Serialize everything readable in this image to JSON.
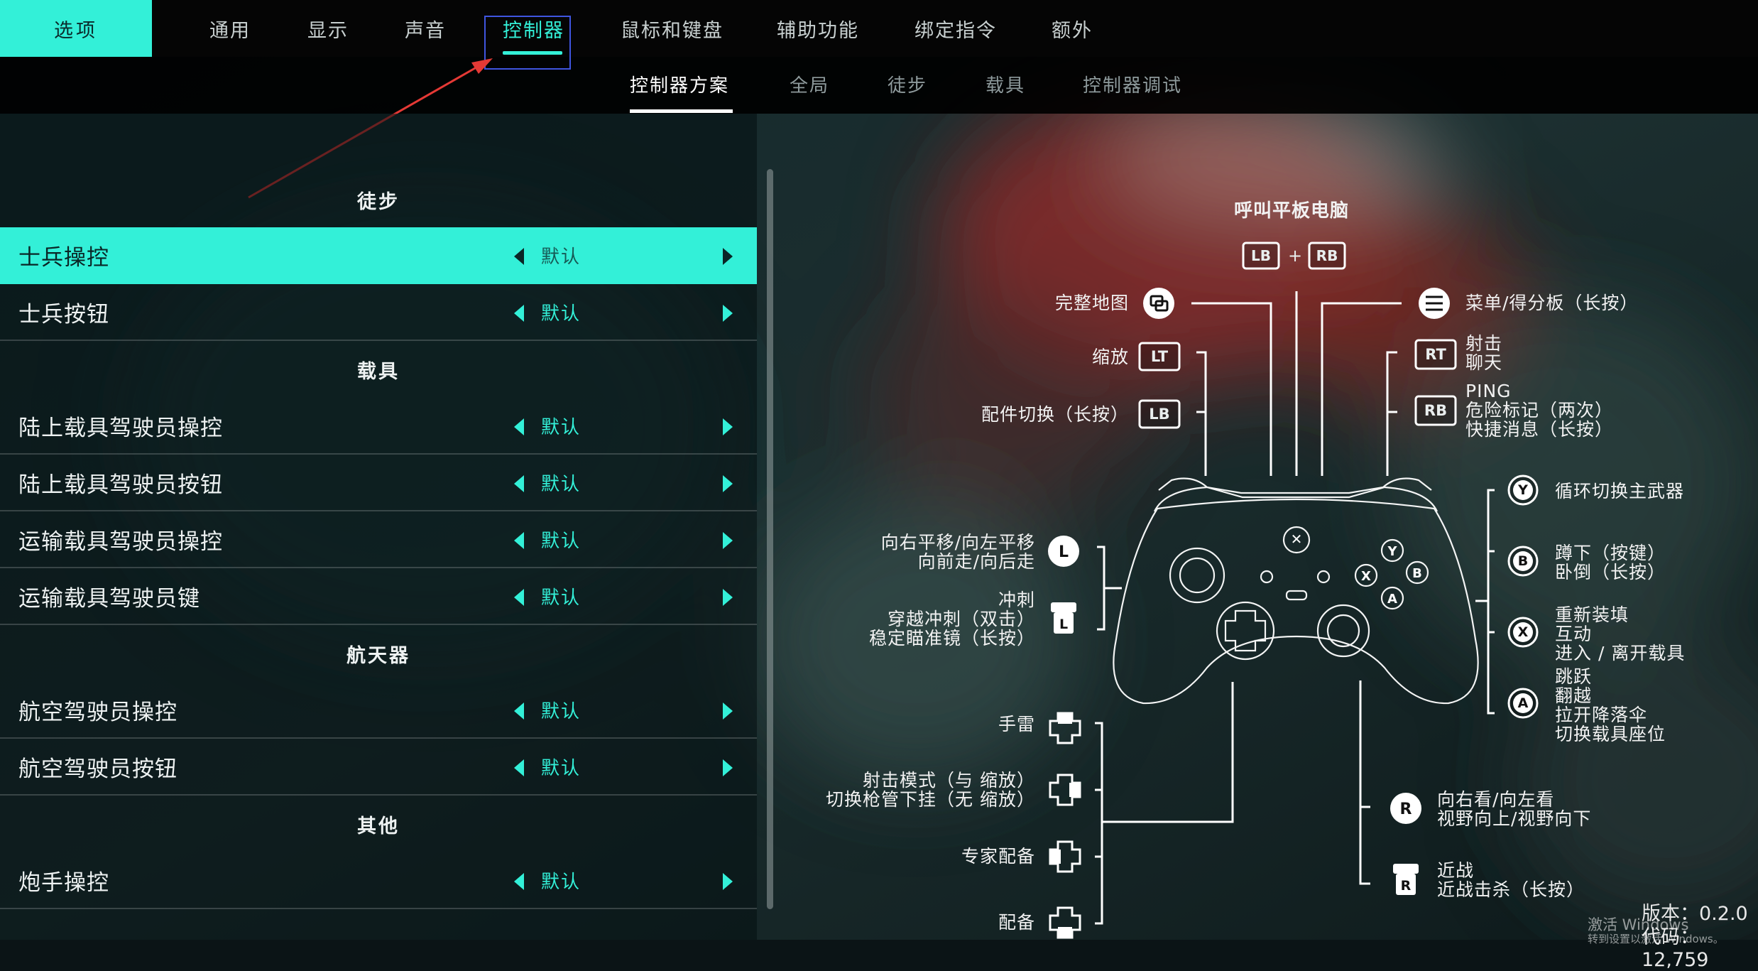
{
  "colors": {
    "accent": "#33f0d8",
    "highlight_box": "#3f55e0",
    "annotation_arrow": "#e53935"
  },
  "top_nav": {
    "options_label": "选项",
    "tabs": [
      "通用",
      "显示",
      "声音",
      "控制器",
      "鼠标和键盘",
      "辅助功能",
      "绑定指令",
      "额外"
    ],
    "active_tab": "控制器"
  },
  "sub_nav": {
    "tabs": [
      "控制器方案",
      "全局",
      "徒步",
      "载具",
      "控制器调试"
    ],
    "active_tab": "控制器方案"
  },
  "left_panel": {
    "sections": [
      "徒步",
      "载具",
      "航天器",
      "其他"
    ],
    "rows": [
      {
        "label": "士兵操控",
        "value": "默认",
        "selected": true
      },
      {
        "label": "士兵按钮",
        "value": "默认"
      },
      {
        "label": "陆上载具驾驶员操控",
        "value": "默认"
      },
      {
        "label": "陆上载具驾驶员按钮",
        "value": "默认"
      },
      {
        "label": "运输载具驾驶员操控",
        "value": "默认"
      },
      {
        "label": "运输载具驾驶员键",
        "value": "默认"
      },
      {
        "label": "航空驾驶员操控",
        "value": "默认"
      },
      {
        "label": "航空驾驶员按钮",
        "value": "默认"
      },
      {
        "label": "炮手操控",
        "value": "默认"
      }
    ]
  },
  "controller_map": {
    "tablet": {
      "title": "呼叫平板电脑",
      "combo_lb": "LB",
      "plus": "+",
      "combo_rb": "RB"
    },
    "full_map": "完整地图",
    "menu": "菜单/得分板（长按）",
    "zoom": "缩放",
    "zoom_key": "LT",
    "attachment": "配件切换（长按）",
    "attachment_key": "LB",
    "rt_key": "RT",
    "rt_actions": [
      "射击",
      "聊天"
    ],
    "rb_key": "RB",
    "rb_actions": [
      "PING",
      "危险标记（两次）",
      "快捷消息（长按）"
    ],
    "y_key": "Y",
    "y_action": "循环切换主武器",
    "b_key": "B",
    "b_actions": [
      "蹲下（按键）",
      "卧倒（长按）"
    ],
    "x_key": "X",
    "x_actions": [
      "重新装填",
      "互动",
      "进入 / 离开载具"
    ],
    "a_key": "A",
    "a_actions": [
      "跳跃",
      "翻越",
      "拉开降落伞",
      "切换载具座位"
    ],
    "left_stick_key": "L",
    "left_stick": [
      "向右平移/向左平移",
      "向前走/向后走"
    ],
    "l3_key": "L",
    "l3": [
      "冲刺",
      "穿越冲刺（双击）",
      "稳定瞄准镜（长按）"
    ],
    "dpad_up": "手雷",
    "dpad_right": [
      "射击模式（与 缩放）",
      "切换枪管下挂（无 缩放）"
    ],
    "dpad_left": "专家配备",
    "dpad_down": "配备",
    "right_stick_key": "R",
    "right_stick": [
      "向右看/向左看",
      "视野向上/视野向下"
    ],
    "r3_key": "R",
    "r3": [
      "近战",
      "近战击杀（长按）"
    ]
  },
  "footer": {
    "watermark": [
      "激活 Windows",
      "转到设置以激活 Windows。"
    ],
    "version": "版本：0.2.0",
    "build": "代码：12,759"
  }
}
